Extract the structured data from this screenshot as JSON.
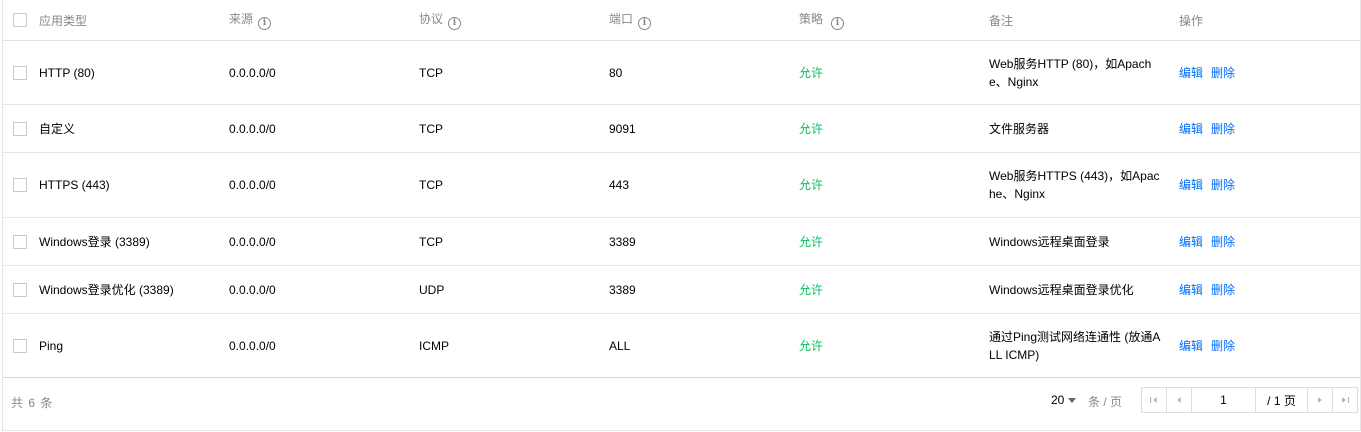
{
  "header": {
    "select_all": "",
    "app_type": "应用类型",
    "source": "来源",
    "protocol": "协议",
    "port": "端口",
    "policy": "策略",
    "remark": "备注",
    "action": "操作",
    "info_glyph": "i"
  },
  "rows": [
    {
      "app_type": "HTTP (80)",
      "source": "0.0.0.0/0",
      "protocol": "TCP",
      "port": "80",
      "policy": "允许",
      "remark": "Web服务HTTP (80)，如Apache、Nginx",
      "edit": "编辑",
      "delete": "删除"
    },
    {
      "app_type": "自定义",
      "source": "0.0.0.0/0",
      "protocol": "TCP",
      "port": "9091",
      "policy": "允许",
      "remark": "文件服务器",
      "edit": "编辑",
      "delete": "删除"
    },
    {
      "app_type": "HTTPS (443)",
      "source": "0.0.0.0/0",
      "protocol": "TCP",
      "port": "443",
      "policy": "允许",
      "remark": "Web服务HTTPS (443)，如Apache、Nginx",
      "edit": "编辑",
      "delete": "删除"
    },
    {
      "app_type": "Windows登录 (3389)",
      "source": "0.0.0.0/0",
      "protocol": "TCP",
      "port": "3389",
      "policy": "允许",
      "remark": "Windows远程桌面登录",
      "edit": "编辑",
      "delete": "删除"
    },
    {
      "app_type": "Windows登录优化 (3389)",
      "source": "0.0.0.0/0",
      "protocol": "UDP",
      "port": "3389",
      "policy": "允许",
      "remark": "Windows远程桌面登录优化",
      "edit": "编辑",
      "delete": "删除"
    },
    {
      "app_type": "Ping",
      "source": "0.0.0.0/0",
      "protocol": "ICMP",
      "port": "ALL",
      "policy": "允许",
      "remark": "通过Ping测试网络连通性 (放通ALL ICMP)",
      "edit": "编辑",
      "delete": "删除"
    }
  ],
  "footer": {
    "total": "共 6 条",
    "page_size": "20",
    "per_page": "条 / 页",
    "page_input": "1",
    "page_total": "/ 1 页"
  },
  "icons": {
    "first": "first-page-icon",
    "prev": "prev-page-icon",
    "next": "next-page-icon",
    "last": "last-page-icon"
  },
  "colors": {
    "allow": "#0abf5b",
    "link": "#006eff",
    "header_text": "#888888"
  }
}
